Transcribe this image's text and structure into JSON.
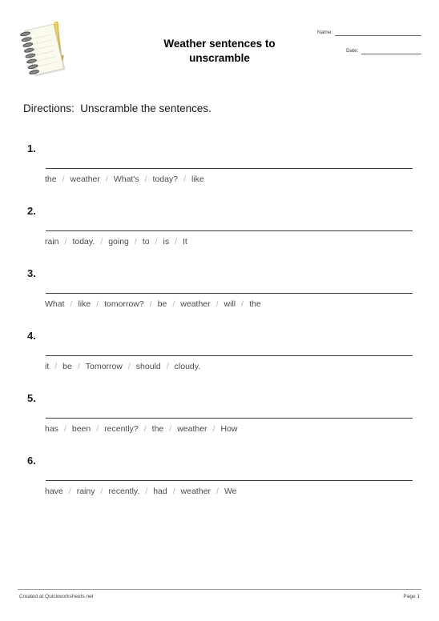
{
  "header": {
    "logo_icon": "notepad-pencil-icon",
    "title_line1": "Weather sentences to",
    "title_line2": "unscramble",
    "name_label": "Name:",
    "date_label": "Date:"
  },
  "directions": "Directions:  Unscramble the sentences.",
  "separator": "/",
  "questions": [
    {
      "number": "1.",
      "words": [
        "the",
        "weather",
        "What's",
        "today?",
        "like"
      ]
    },
    {
      "number": "2.",
      "words": [
        "rain",
        "today.",
        "going",
        "to",
        "is",
        "It"
      ]
    },
    {
      "number": "3.",
      "words": [
        "What",
        "like",
        "tomorrow?",
        "be",
        "weather",
        "will",
        "the"
      ]
    },
    {
      "number": "4.",
      "words": [
        "it",
        "be",
        "Tomorrow",
        "should",
        "cloudy."
      ]
    },
    {
      "number": "5.",
      "words": [
        "has",
        "been",
        "recently?",
        "the",
        "weather",
        "How"
      ]
    },
    {
      "number": "6.",
      "words": [
        "have",
        "rainy",
        "recently.",
        "had",
        "weather",
        "We"
      ]
    }
  ],
  "footer": {
    "credit": "Created at Quickworksheets.net",
    "page": "Page 1"
  },
  "colors": {
    "text": "#1a1a1a",
    "word": "#4a4a4a",
    "separator": "#b4b4b4",
    "rule": "#3d3d3d",
    "footer": "#444444"
  }
}
